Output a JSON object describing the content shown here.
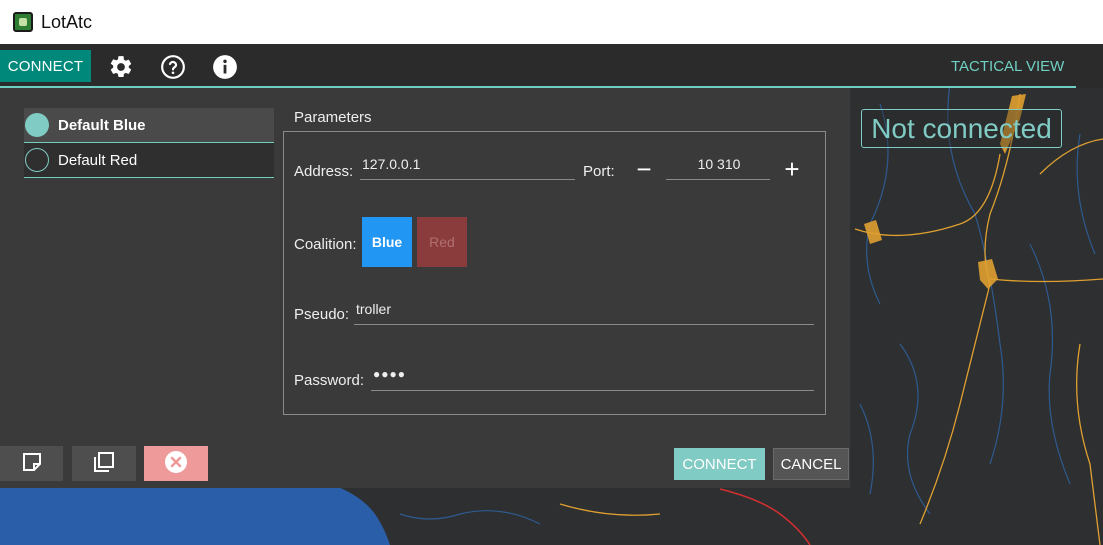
{
  "app": {
    "title": "LotAtc"
  },
  "toolbar": {
    "connect_label": "CONNECT",
    "view_label": "TACTICAL VIEW",
    "icons": [
      "gear-icon",
      "help-icon",
      "info-icon"
    ]
  },
  "map": {
    "status_text": "Not connected"
  },
  "profiles": {
    "items": [
      {
        "label": "Default Blue",
        "selected": true
      },
      {
        "label": "Default Red",
        "selected": false
      }
    ]
  },
  "parameters": {
    "title": "Parameters",
    "address_label": "Address:",
    "address_value": "127.0.0.1",
    "port_label": "Port:",
    "port_value": "10 310",
    "coalition_label": "Coalition:",
    "coalition_blue": "Blue",
    "coalition_red": "Red",
    "pseudo_label": "Pseudo:",
    "pseudo_value": "troller",
    "password_label": "Password:",
    "password_value": "●●●●"
  },
  "actions": {
    "connect_label": "CONNECT",
    "cancel_label": "CANCEL"
  },
  "colors": {
    "accent": "#80cbc4",
    "toolbar_connect": "#00897b",
    "blue": "#2196f3",
    "red": "#8a3b3b",
    "delete": "#ef9a9a",
    "water": "#2b5ea8",
    "roads": "#e0a030"
  }
}
